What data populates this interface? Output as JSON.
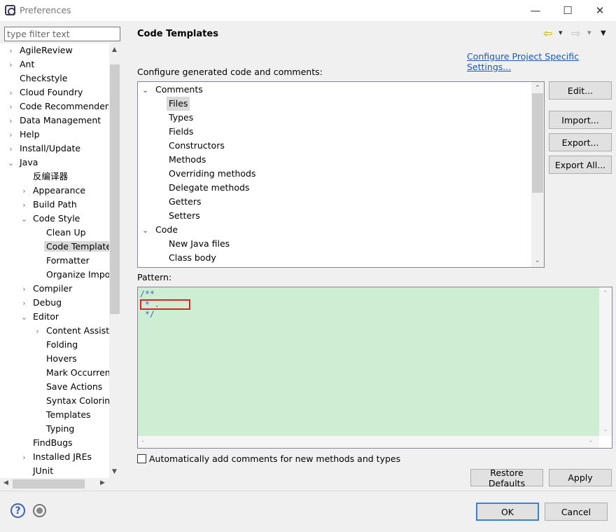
{
  "window": {
    "title": "Preferences",
    "minimize": "—",
    "maximize": "☐",
    "close": "✕"
  },
  "filter": {
    "placeholder": "type filter text"
  },
  "left_tree": [
    {
      "label": "AgileReview",
      "level": 0,
      "twisty": "›"
    },
    {
      "label": "Ant",
      "level": 0,
      "twisty": "›"
    },
    {
      "label": "Checkstyle",
      "level": 0,
      "twisty": ""
    },
    {
      "label": "Cloud Foundry",
      "level": 0,
      "twisty": "›"
    },
    {
      "label": "Code Recommenders",
      "level": 0,
      "twisty": "›"
    },
    {
      "label": "Data Management",
      "level": 0,
      "twisty": "›"
    },
    {
      "label": "Help",
      "level": 0,
      "twisty": "›"
    },
    {
      "label": "Install/Update",
      "level": 0,
      "twisty": "›"
    },
    {
      "label": "Java",
      "level": 0,
      "twisty": "⌄"
    },
    {
      "label": "反编译器",
      "level": 1,
      "twisty": ""
    },
    {
      "label": "Appearance",
      "level": 1,
      "twisty": "›"
    },
    {
      "label": "Build Path",
      "level": 1,
      "twisty": "›"
    },
    {
      "label": "Code Style",
      "level": 1,
      "twisty": "⌄"
    },
    {
      "label": "Clean Up",
      "level": 2,
      "twisty": ""
    },
    {
      "label": "Code Templates",
      "level": 2,
      "twisty": "",
      "selected": true
    },
    {
      "label": "Formatter",
      "level": 2,
      "twisty": ""
    },
    {
      "label": "Organize Imports",
      "level": 2,
      "twisty": ""
    },
    {
      "label": "Compiler",
      "level": 1,
      "twisty": "›"
    },
    {
      "label": "Debug",
      "level": 1,
      "twisty": "›"
    },
    {
      "label": "Editor",
      "level": 1,
      "twisty": "⌄"
    },
    {
      "label": "Content Assist",
      "level": 2,
      "twisty": "›"
    },
    {
      "label": "Folding",
      "level": 2,
      "twisty": ""
    },
    {
      "label": "Hovers",
      "level": 2,
      "twisty": ""
    },
    {
      "label": "Mark Occurrences",
      "level": 2,
      "twisty": ""
    },
    {
      "label": "Save Actions",
      "level": 2,
      "twisty": ""
    },
    {
      "label": "Syntax Coloring",
      "level": 2,
      "twisty": ""
    },
    {
      "label": "Templates",
      "level": 2,
      "twisty": ""
    },
    {
      "label": "Typing",
      "level": 2,
      "twisty": ""
    },
    {
      "label": "FindBugs",
      "level": 1,
      "twisty": ""
    },
    {
      "label": "Installed JREs",
      "level": 1,
      "twisty": "›"
    },
    {
      "label": "JUnit",
      "level": 1,
      "twisty": ""
    }
  ],
  "page": {
    "title": "Code Templates",
    "config_link": "Configure Project Specific Settings...",
    "config_label": "Configure generated code and comments:",
    "pattern_label": "Pattern:",
    "pattern_text": "/**\n * .\n */",
    "auto_comments_label": "Automatically add comments for new methods and types"
  },
  "template_tree": [
    {
      "label": "Comments",
      "level": 0,
      "twisty": "⌄"
    },
    {
      "label": "Files",
      "level": 1,
      "selected": true
    },
    {
      "label": "Types",
      "level": 1
    },
    {
      "label": "Fields",
      "level": 1
    },
    {
      "label": "Constructors",
      "level": 1
    },
    {
      "label": "Methods",
      "level": 1
    },
    {
      "label": "Overriding methods",
      "level": 1
    },
    {
      "label": "Delegate methods",
      "level": 1
    },
    {
      "label": "Getters",
      "level": 1
    },
    {
      "label": "Setters",
      "level": 1
    },
    {
      "label": "Code",
      "level": 0,
      "twisty": "⌄"
    },
    {
      "label": "New Java files",
      "level": 1
    },
    {
      "label": "Class body",
      "level": 1
    }
  ],
  "buttons": {
    "edit": "Edit...",
    "import": "Import...",
    "export": "Export...",
    "export_all": "Export All...",
    "restore_defaults": "Restore Defaults",
    "apply": "Apply",
    "ok": "OK",
    "cancel": "Cancel"
  },
  "icons": {
    "back": "⇦",
    "forward": "⇨",
    "dropdown": "▾",
    "menu": "▼",
    "help": "?"
  }
}
